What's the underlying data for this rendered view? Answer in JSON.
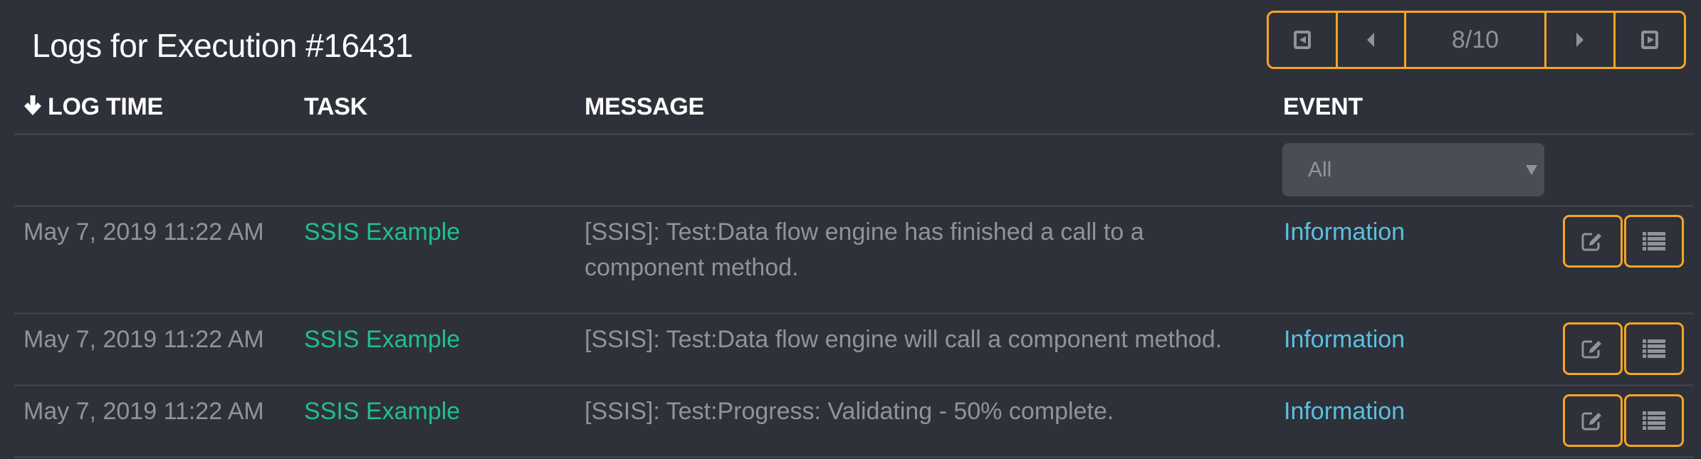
{
  "header": {
    "title": "Logs for Execution #16431"
  },
  "pagination": {
    "first_icon": "first-page-icon",
    "prev_icon": "caret-left-icon",
    "page_label": "8/10",
    "current_page": 8,
    "total_pages": 10,
    "next_icon": "caret-right-icon",
    "last_icon": "last-page-icon"
  },
  "table": {
    "columns": [
      {
        "label": "LOG TIME",
        "sort": "descending",
        "sort_icon": "arrow-down-icon"
      },
      {
        "label": "TASK"
      },
      {
        "label": "MESSAGE"
      },
      {
        "label": "EVENT"
      }
    ],
    "filters": {
      "event": {
        "selected": "All"
      }
    },
    "rows": [
      {
        "log_time": "May 7, 2019 11:22 AM",
        "task": "SSIS Example",
        "message": "[SSIS]: Test:Data flow engine has finished a call to a component method.",
        "event": "Information"
      },
      {
        "log_time": "May 7, 2019 11:22 AM",
        "task": "SSIS Example",
        "message": "[SSIS]: Test:Data flow engine will call a component method.",
        "event": "Information"
      },
      {
        "log_time": "May 7, 2019 11:22 AM",
        "task": "SSIS Example",
        "message": "[SSIS]: Test:Progress: Validating - 50% complete.",
        "event": "Information"
      }
    ],
    "row_actions": [
      {
        "icon": "edit-icon"
      },
      {
        "icon": "list-icon"
      }
    ]
  },
  "colors": {
    "background": "#2e313a",
    "accent_border": "#f5a623",
    "task_link": "#1fbf8f",
    "event_link": "#5bc0de",
    "muted_text": "#8f939b",
    "select_bg": "#4a4d56"
  }
}
